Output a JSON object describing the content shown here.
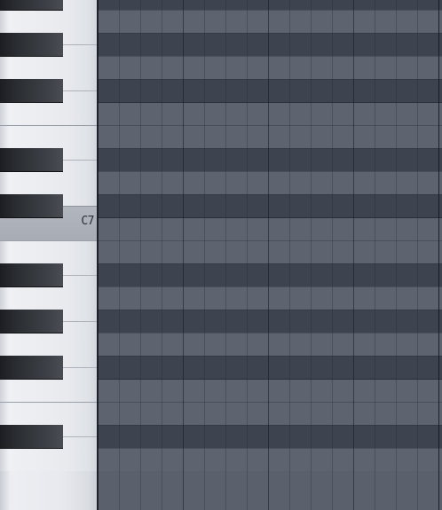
{
  "piano_roll": {
    "keys": [
      {
        "id": "A#7",
        "label": "",
        "black": true
      },
      {
        "id": "A7",
        "label": "",
        "black": false
      },
      {
        "id": "G#7",
        "label": "",
        "black": true
      },
      {
        "id": "G7",
        "label": "",
        "black": false
      },
      {
        "id": "F#7",
        "label": "",
        "black": true
      },
      {
        "id": "F7",
        "label": "",
        "black": false
      },
      {
        "id": "E7",
        "label": "",
        "black": false
      },
      {
        "id": "D#7",
        "label": "",
        "black": true
      },
      {
        "id": "D7",
        "label": "",
        "black": false
      },
      {
        "id": "C#7",
        "label": "",
        "black": true
      },
      {
        "id": "C7",
        "label": "C7",
        "black": false,
        "active": true
      },
      {
        "id": "B6",
        "label": "",
        "black": false
      },
      {
        "id": "A#6",
        "label": "",
        "black": true
      },
      {
        "id": "A6",
        "label": "",
        "black": false
      },
      {
        "id": "G#6",
        "label": "",
        "black": true
      },
      {
        "id": "G6",
        "label": "",
        "black": false
      },
      {
        "id": "F#6",
        "label": "",
        "black": true
      },
      {
        "id": "F6",
        "label": "",
        "black": false
      },
      {
        "id": "E6",
        "label": "",
        "black": false
      },
      {
        "id": "D#6",
        "label": "",
        "black": true
      },
      {
        "id": "D6",
        "label": "",
        "black": false
      }
    ],
    "c_key_label": "C7",
    "colors": {
      "grid_light_row": "#5d6470",
      "grid_dark_row": "#3e444f",
      "black_key": "#2b2e33",
      "white_key": "#e8eaee",
      "active_key": "#a7abb4"
    }
  }
}
